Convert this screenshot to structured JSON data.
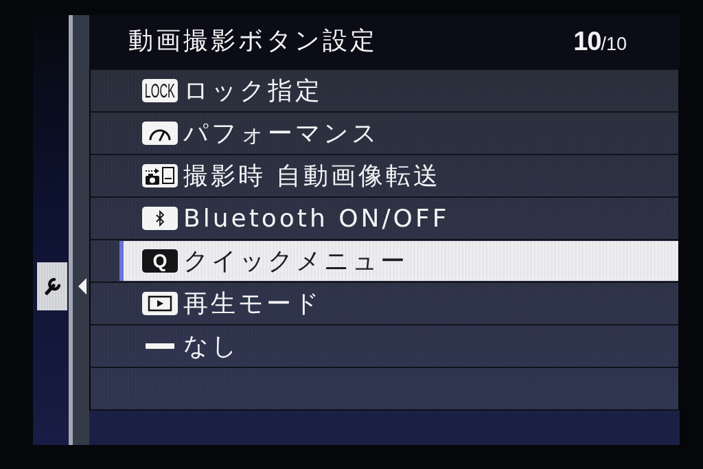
{
  "sidebar": {
    "tabs": [
      {
        "selected": true
      }
    ]
  },
  "header": {
    "title": "動画撮影ボタン設定",
    "page": {
      "current": "10",
      "total": "/10"
    }
  },
  "menu": {
    "items": [
      {
        "kind": "tag",
        "badge": "LOCK",
        "label": "ロック指定",
        "selected": false
      },
      {
        "kind": "gauge",
        "label": "パフォーマンス",
        "selected": false
      },
      {
        "kind": "transfer",
        "label": "撮影時 自動画像転送",
        "selected": false
      },
      {
        "kind": "bluetooth",
        "label": "Bluetooth ON/OFF",
        "selected": false
      },
      {
        "kind": "letter",
        "badge": "Q",
        "label": "クイックメニュー",
        "selected": true
      },
      {
        "kind": "playback",
        "label": "再生モード",
        "selected": false
      },
      {
        "kind": "dash",
        "label": "なし",
        "selected": false
      }
    ]
  }
}
